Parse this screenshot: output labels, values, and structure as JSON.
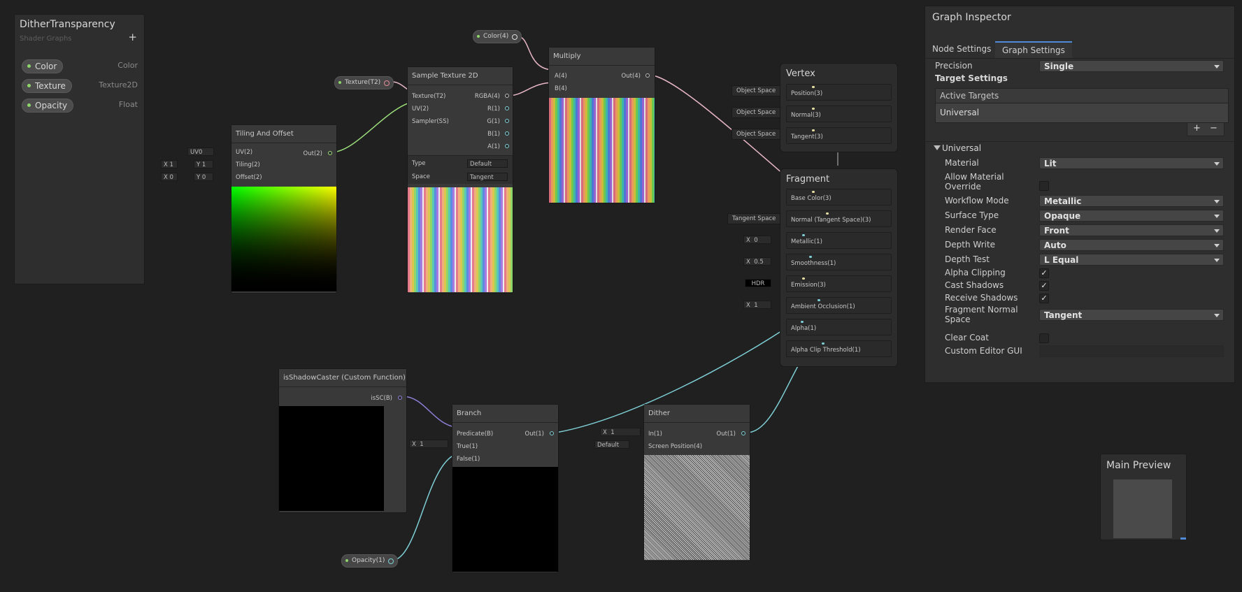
{
  "blackboard": {
    "title": "DitherTransparency",
    "subtitle": "Shader Graphs",
    "add_label": "+",
    "properties": [
      {
        "name": "Color",
        "type": "Color"
      },
      {
        "name": "Texture",
        "type": "Texture2D"
      },
      {
        "name": "Opacity",
        "type": "Float"
      }
    ]
  },
  "chips": {
    "color": "Color(4)",
    "texture": "Texture(T2)",
    "opacity": "Opacity(1)"
  },
  "tiling": {
    "title": "Tiling And Offset",
    "in_uv": "UV(2)",
    "in_tiling": "Tiling(2)",
    "in_offset": "Offset(2)",
    "out": "Out(2)",
    "uv_value": "UV0",
    "tiling_x": "1",
    "tiling_y": "1",
    "offset_x": "0",
    "offset_y": "0",
    "x_label": "X",
    "y_label": "Y"
  },
  "sample": {
    "title": "Sample Texture 2D",
    "in_texture": "Texture(T2)",
    "in_uv": "UV(2)",
    "in_sampler": "Sampler(SS)",
    "out_rgba": "RGBA(4)",
    "out_r": "R(1)",
    "out_g": "G(1)",
    "out_b": "B(1)",
    "out_a": "A(1)",
    "type_label": "Type",
    "type_value": "Default",
    "space_label": "Space",
    "space_value": "Tangent"
  },
  "multiply": {
    "title": "Multiply",
    "in_a": "A(4)",
    "in_b": "B(4)",
    "out": "Out(4)"
  },
  "vertex": {
    "title": "Vertex",
    "space_tag": "Object Space",
    "slots": [
      "Position(3)",
      "Normal(3)",
      "Tangent(3)"
    ]
  },
  "fragment": {
    "title": "Fragment",
    "slots": [
      "Base Color(3)",
      "Normal (Tangent Space)(3)",
      "Metallic(1)",
      "Smoothness(1)",
      "Emission(3)",
      "Ambient Occlusion(1)",
      "Alpha(1)",
      "Alpha Clip Threshold(1)"
    ],
    "tangent_tag": "Tangent Space",
    "metallic_value": "0",
    "smoothness_value": "0.5",
    "hdr_label": "HDR",
    "ao_value": "1",
    "x_label": "X"
  },
  "custom_fn": {
    "title": "isShadowCaster (Custom Function)",
    "out": "isSC(B)"
  },
  "branch": {
    "title": "Branch",
    "in_predicate": "Predicate(B)",
    "in_true": "True(1)",
    "in_false": "False(1)",
    "out": "Out(1)",
    "true_value": "1",
    "x_label": "X"
  },
  "dither": {
    "title": "Dither",
    "in_in": "In(1)",
    "in_screen": "Screen Position(4)",
    "out": "Out(1)",
    "in_value": "1",
    "screen_value": "Default",
    "x_label": "X"
  },
  "inspector": {
    "title": "Graph Inspector",
    "tabs": [
      "Node Settings",
      "Graph Settings"
    ],
    "precision_label": "Precision",
    "precision_value": "Single",
    "target_settings": "Target Settings",
    "active_targets": "Active Targets",
    "target_item": "Universal",
    "add_btn": "+",
    "remove_btn": "−",
    "universal_header": "Universal",
    "material_label": "Material",
    "material_value": "Lit",
    "allow_override_label": "Allow Material Override",
    "allow_override": false,
    "workflow_label": "Workflow Mode",
    "workflow_value": "Metallic",
    "surface_label": "Surface Type",
    "surface_value": "Opaque",
    "render_face_label": "Render Face",
    "render_face_value": "Front",
    "depth_write_label": "Depth Write",
    "depth_write_value": "Auto",
    "depth_test_label": "Depth Test",
    "depth_test_value": "L Equal",
    "alpha_clip_label": "Alpha Clipping",
    "alpha_clip": true,
    "cast_shadows_label": "Cast Shadows",
    "cast_shadows": true,
    "receive_shadows_label": "Receive Shadows",
    "receive_shadows": true,
    "frag_normal_label": "Fragment Normal Space",
    "frag_normal_value": "Tangent",
    "clear_coat_label": "Clear Coat",
    "clear_coat": false,
    "custom_gui_label": "Custom Editor GUI",
    "custom_gui_value": ""
  },
  "main_preview": {
    "title": "Main Preview"
  },
  "colors": {
    "background": "#202020",
    "wire_vector": "#e8b7c6",
    "wire_uv": "#9bdc7a",
    "wire_float": "#7ecfd6",
    "wire_bool": "#8e80d8",
    "wire_vec3": "#e6e0a3",
    "accent": "#4f8bd6"
  }
}
